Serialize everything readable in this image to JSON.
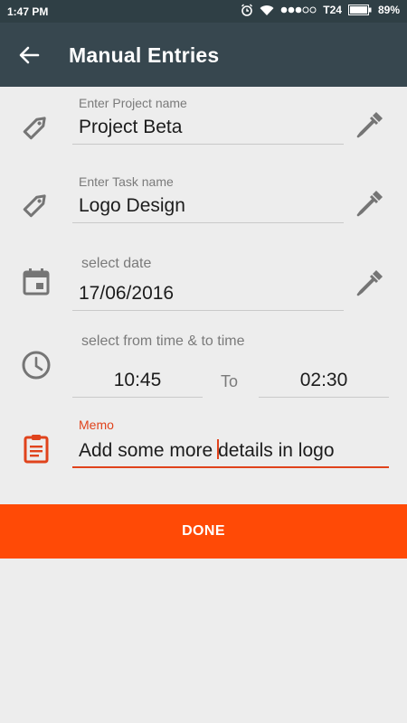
{
  "status_bar": {
    "time": "1:47 PM",
    "carrier": "T24",
    "battery": "89%",
    "icons": [
      "alarm-icon",
      "wifi-icon",
      "signal-dots-icon",
      "battery-icon"
    ]
  },
  "app_bar": {
    "title": "Manual Entries",
    "back_icon": "arrow-left-icon"
  },
  "form": {
    "project": {
      "label": "Enter Project name",
      "value": "Project Beta",
      "icon": "tag-icon",
      "action_icon": "eyedropper-icon"
    },
    "task": {
      "label": "Enter Task name",
      "value": "Logo Design",
      "icon": "tag-icon",
      "action_icon": "eyedropper-icon"
    },
    "date": {
      "label": "select date",
      "value": "17/06/2016",
      "icon": "calendar-icon",
      "action_icon": "eyedropper-icon"
    },
    "time": {
      "label": "select from time & to time",
      "from": "10:45",
      "separator": "To",
      "to": "02:30",
      "icon": "clock-icon"
    },
    "memo": {
      "label": "Memo",
      "value_before_cursor": "Add some more ",
      "value_after_cursor": "details in logo",
      "icon": "clipboard-icon"
    }
  },
  "actions": {
    "done_label": "DONE"
  },
  "colors": {
    "app_bar": "#37474f",
    "status_bar": "#2f3f45",
    "accent": "#ff4a06",
    "memo_accent": "#e0431c",
    "background": "#ededed"
  }
}
